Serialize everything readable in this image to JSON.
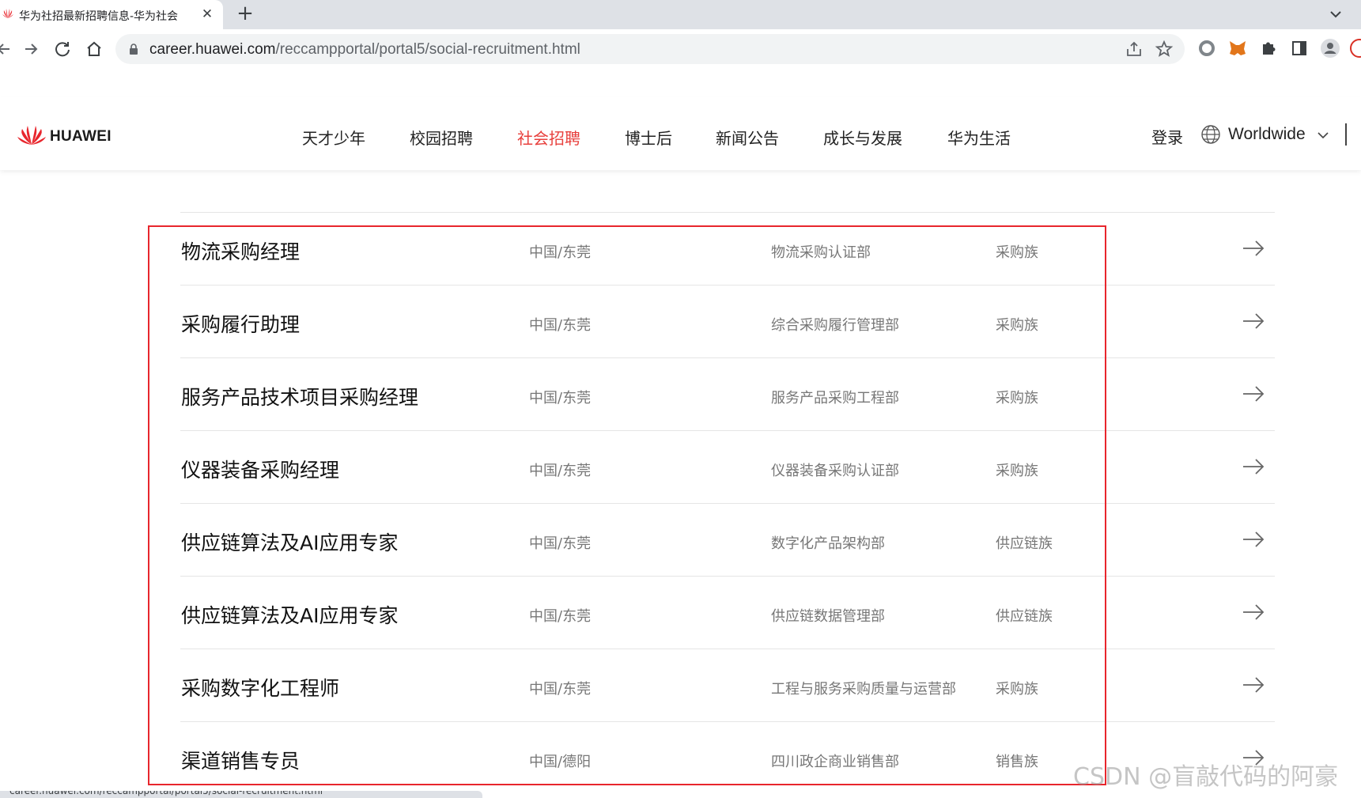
{
  "browser": {
    "tab": {
      "title": "华为社招最新招聘信息-华为社会"
    },
    "url": {
      "host": "career.huawei.com",
      "path": "/reccampportal/portal5/social-recruitment.html"
    }
  },
  "header": {
    "logo_text": "HUAWEI",
    "nav": [
      "天才少年",
      "校园招聘",
      "社会招聘",
      "博士后",
      "新闻公告",
      "成长与发展",
      "华为生活"
    ],
    "active_nav": "社会招聘",
    "login": "登录",
    "region": "Worldwide"
  },
  "jobs": [
    {
      "title": "物流采购经理",
      "location": "中国/东莞",
      "department": "物流采购认证部",
      "family": "采购族"
    },
    {
      "title": "采购履行助理",
      "location": "中国/东莞",
      "department": "综合采购履行管理部",
      "family": "采购族"
    },
    {
      "title": "服务产品技术项目采购经理",
      "location": "中国/东莞",
      "department": "服务产品采购工程部",
      "family": "采购族"
    },
    {
      "title": "仪器装备采购经理",
      "location": "中国/东莞",
      "department": "仪器装备采购认证部",
      "family": "采购族"
    },
    {
      "title": "供应链算法及AI应用专家",
      "location": "中国/东莞",
      "department": "数字化产品架构部",
      "family": "供应链族"
    },
    {
      "title": "供应链算法及AI应用专家",
      "location": "中国/东莞",
      "department": "供应链数据管理部",
      "family": "供应链族"
    },
    {
      "title": "采购数字化工程师",
      "location": "中国/东莞",
      "department": "工程与服务采购质量与运营部",
      "family": "采购族"
    },
    {
      "title": "渠道销售专员",
      "location": "中国/德阳",
      "department": "四川政企商业销售部",
      "family": "销售族"
    }
  ],
  "watermark": "CSDN @盲敲代码的阿豪",
  "colors": {
    "brand_red": "#e8403d",
    "annotation_red": "#e8262d"
  }
}
